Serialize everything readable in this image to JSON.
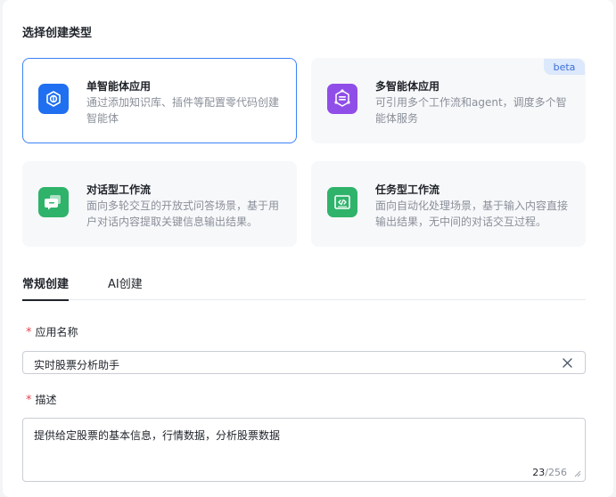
{
  "section_title": "选择创建类型",
  "cards": [
    {
      "title": "单智能体应用",
      "desc": "通过添加知识库、插件等配置零代码创建智能体",
      "icon": "single-agent-icon",
      "color": "#1f6ff0",
      "selected": true
    },
    {
      "title": "多智能体应用",
      "desc": "可引用多个工作流和agent，调度多个智能体服务",
      "icon": "multi-agent-icon",
      "color": "#8f4ee8",
      "badge": "beta"
    },
    {
      "title": "对话型工作流",
      "desc": "面向多轮交互的开放式问答场景，基于用户对话内容提取关键信息输出结果。",
      "icon": "chat-workflow-icon",
      "color": "#2fb36b"
    },
    {
      "title": "任务型工作流",
      "desc": "面向自动化处理场景，基于输入内容直接输出结果，无中间的对话交互过程。",
      "icon": "task-workflow-icon",
      "color": "#2fb36b"
    }
  ],
  "tabs": {
    "regular": "常规创建",
    "ai": "AI创建"
  },
  "form": {
    "required_mark": "*",
    "name_label": "应用名称",
    "name_value": "实时股票分析助手",
    "desc_label": "描述",
    "desc_value": "提供给定股票的基本信息，行情数据，分析股票数据",
    "counter_current": "23",
    "counter_max": "/256"
  }
}
